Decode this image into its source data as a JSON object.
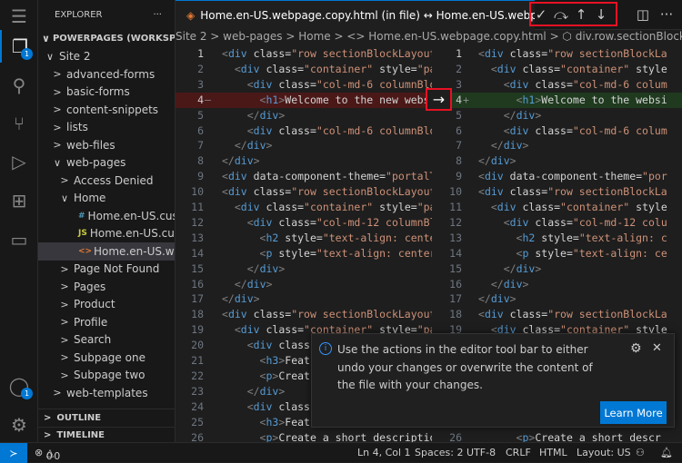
{
  "activity": {
    "explorer_badge": "1",
    "accounts_badge": "1"
  },
  "explorer": {
    "title": "EXPLORER",
    "more": "···",
    "workspace": "POWERPAGES (WORKSPA...",
    "items": [
      {
        "label": "Site 2",
        "depth": 0,
        "chev": "∨"
      },
      {
        "label": "advanced-forms",
        "depth": 1,
        "chev": ">"
      },
      {
        "label": "basic-forms",
        "depth": 1,
        "chev": ">"
      },
      {
        "label": "content-snippets",
        "depth": 1,
        "chev": ">"
      },
      {
        "label": "lists",
        "depth": 1,
        "chev": ">"
      },
      {
        "label": "web-files",
        "depth": 1,
        "chev": ">"
      },
      {
        "label": "web-pages",
        "depth": 1,
        "chev": "∨"
      },
      {
        "label": "Access Denied",
        "depth": 2,
        "chev": ">"
      },
      {
        "label": "Home",
        "depth": 2,
        "chev": "∨"
      },
      {
        "label": "Home.en-US.cust...",
        "depth": 3,
        "icon": "#",
        "iconColor": "#519aba"
      },
      {
        "label": "Home.en-US.cust...",
        "depth": 3,
        "icon": "JS",
        "iconColor": "#cbcb41"
      },
      {
        "label": "Home.en-US.web...",
        "depth": 3,
        "icon": "<>",
        "iconColor": "#e37933",
        "selected": true
      },
      {
        "label": "Page Not Found",
        "depth": 2,
        "chev": ">"
      },
      {
        "label": "Pages",
        "depth": 2,
        "chev": ">"
      },
      {
        "label": "Product",
        "depth": 2,
        "chev": ">"
      },
      {
        "label": "Profile",
        "depth": 2,
        "chev": ">"
      },
      {
        "label": "Search",
        "depth": 2,
        "chev": ">"
      },
      {
        "label": "Subpage one",
        "depth": 2,
        "chev": ">"
      },
      {
        "label": "Subpage two",
        "depth": 2,
        "chev": ">"
      },
      {
        "label": "web-templates",
        "depth": 1,
        "chev": ">"
      }
    ],
    "outline": "OUTLINE",
    "timeline": "TIMELINE"
  },
  "tab": {
    "title": "Home.en-US.webpage.copy.html (in file) ↔ Home.en-US.webpage.copy.html"
  },
  "breadcrumb": "Site 2 > web-pages > Home > <> Home.en-US.webpage.copy.html > ⬡ div.row.sectionBlockLayout.text-left",
  "toolbar": {
    "accept": "✓",
    "revert": "⤼",
    "prev": "↑",
    "next": "↓",
    "split": "◫",
    "more": "···"
  },
  "left_lines": [
    "<div class=\"row sectionBlockLayout",
    "  <div class=\"container\" style=\"pa",
    "    <div class=\"col-md-6 columnBlo",
    "      <h1>Welcome to the new webs",
    "    </div>",
    "    <div class=\"col-md-6 columnBlo",
    "  </div>",
    "</div>",
    "<div data-component-theme=\"portalT",
    "<div class=\"row sectionBlockLayout",
    "  <div class=\"container\" style=\"pa",
    "    <div class=\"col-md-12 columnBl",
    "      <h2 style=\"text-align: cente",
    "      <p style=\"text-align: center",
    "    </div>",
    "  </div>",
    "</div>",
    "<div class=\"row sectionBlockLayout",
    "  <div class=\"container\" style=\"pa",
    "    <div class",
    "      <h3>Feat",
    "      <p>Creat",
    "    </div>",
    "    <div class",
    "      <h3>Feat",
    "      <p>Create a short descriptio"
  ],
  "right_lines": [
    "<div class=\"row sectionBlockLa",
    "  <div class=\"container\" style",
    "    <div class=\"col-md-6 colum",
    "      <h1>Welcome to the websi",
    "    </div>",
    "    <div class=\"col-md-6 colum",
    "  </div>",
    "</div>",
    "<div data-component-theme=\"por",
    "<div class=\"row sectionBlockLa",
    "  <div class=\"container\" style",
    "    <div class=\"col-md-12 colu",
    "      <h2 style=\"text-align: c",
    "      <p style=\"text-align: ce",
    "    </div>",
    "  </div>",
    "</div>",
    "<div class=\"row sectionBlockLa",
    "  <div class=\"container\" style",
    "",
    "",
    "",
    "",
    "",
    "",
    "      <p>Create a short descr"
  ],
  "diff": {
    "changed_line": 4,
    "left_marker": "—",
    "right_marker": "+",
    "copy_arrow": "→",
    "removed_color": "#4b1818",
    "added_color": "#1f3a1f"
  },
  "notification": {
    "message": "Use the actions in the editor tool bar to either undo your changes or overwrite the content of the file with your changes.",
    "button": "Learn More"
  },
  "status": {
    "errors": "0",
    "warnings": "0",
    "position": "Ln 4, Col 1",
    "spaces": "Spaces: 2",
    "encoding": "UTF-8",
    "eol": "CRLF",
    "language": "HTML",
    "layout": "Layout: US"
  }
}
